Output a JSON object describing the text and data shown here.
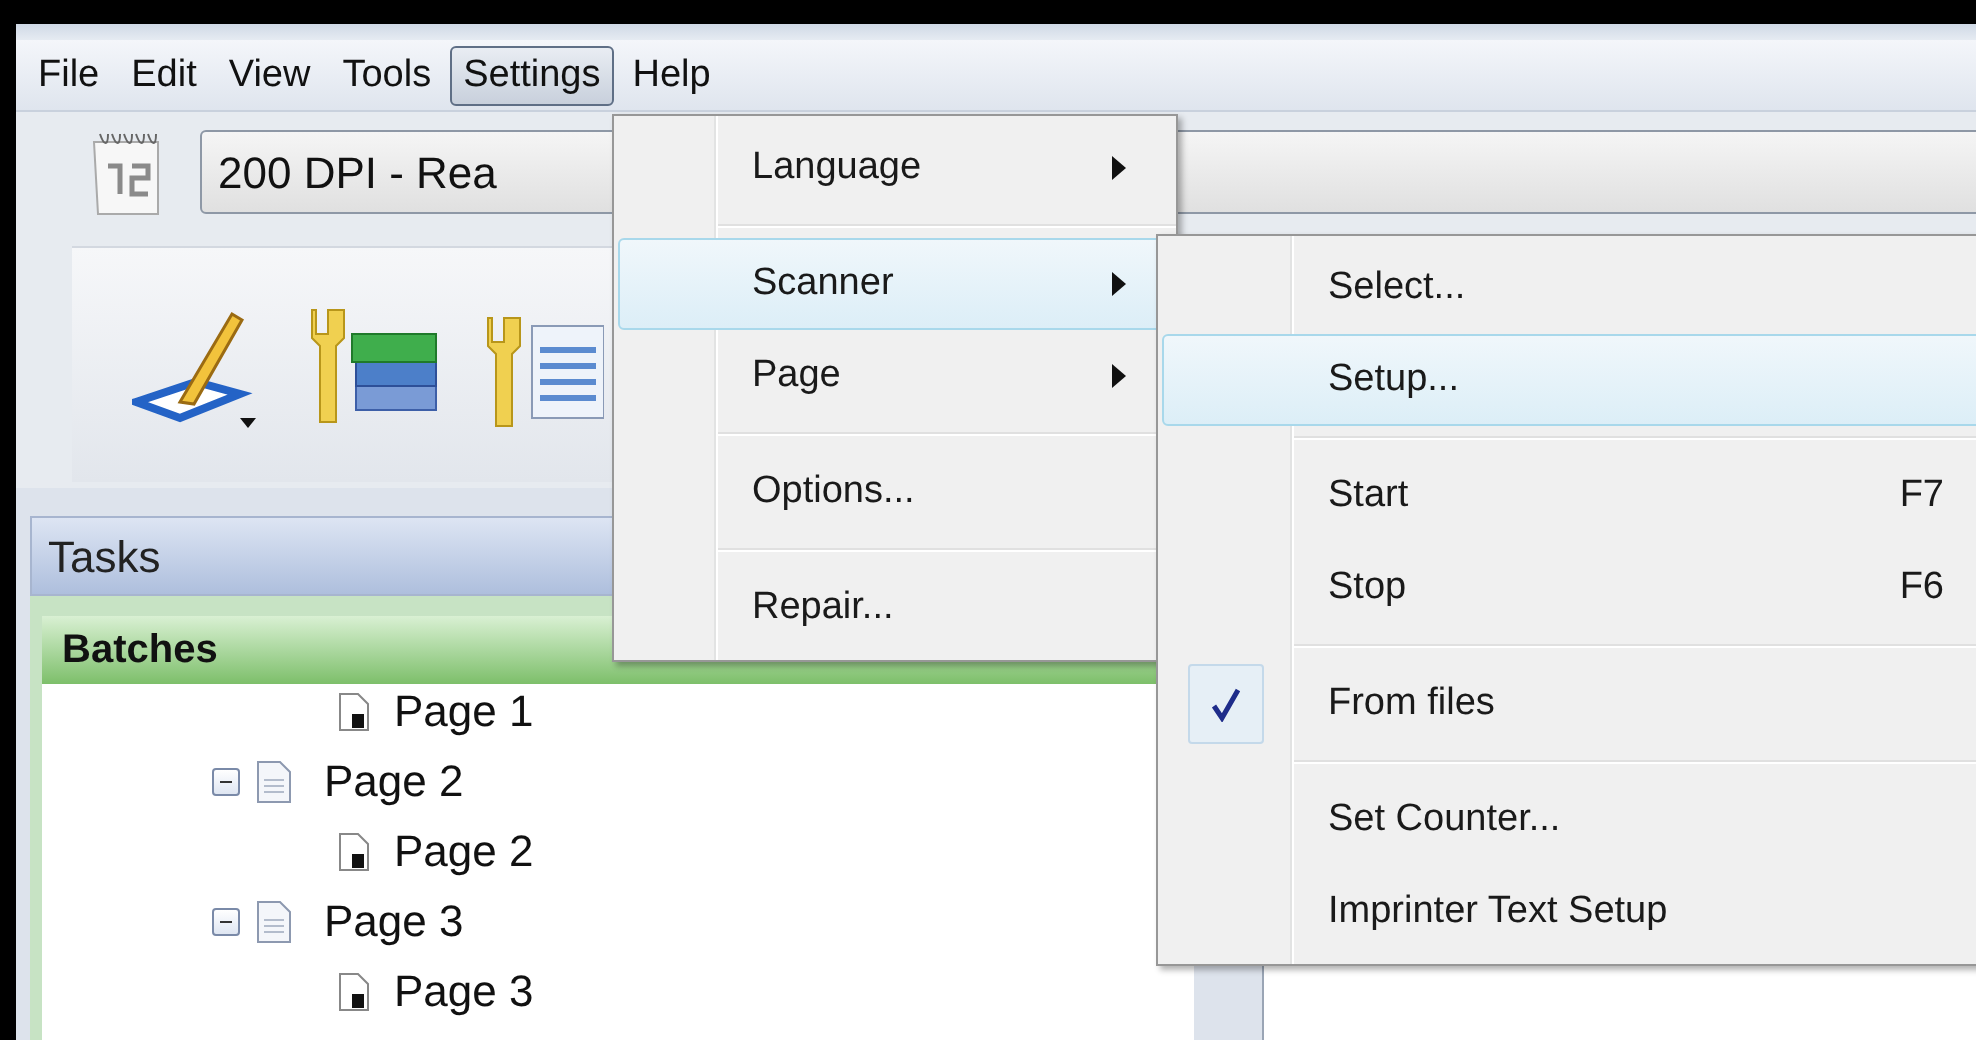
{
  "menubar": [
    {
      "label": "File",
      "selected": false
    },
    {
      "label": "Edit",
      "selected": false
    },
    {
      "label": "View",
      "selected": false
    },
    {
      "label": "Tools",
      "selected": false
    },
    {
      "label": "Settings",
      "selected": true
    },
    {
      "label": "Help",
      "selected": false
    }
  ],
  "toolbar": {
    "profile_combo": {
      "value": "200 DPI - Rea"
    }
  },
  "tasks_panel": {
    "title": "Tasks",
    "section": "Batches",
    "tree": {
      "partial_children": [
        {
          "label": "Page 1"
        }
      ],
      "items": [
        {
          "label": "Page 2",
          "expanded": true,
          "children": [
            {
              "label": "Page 2"
            }
          ]
        },
        {
          "label": "Page 3",
          "expanded": true,
          "children": [
            {
              "label": "Page 3"
            }
          ]
        }
      ]
    }
  },
  "settings_menu": [
    {
      "kind": "item",
      "label": "Language",
      "submenu": true,
      "selected": false
    },
    {
      "kind": "separator"
    },
    {
      "kind": "item",
      "label": "Scanner",
      "submenu": true,
      "selected": true
    },
    {
      "kind": "item",
      "label": "Page",
      "submenu": true,
      "selected": false
    },
    {
      "kind": "separator"
    },
    {
      "kind": "item",
      "label": "Options...",
      "submenu": false,
      "selected": false
    },
    {
      "kind": "separator"
    },
    {
      "kind": "item",
      "label": "Repair...",
      "submenu": false,
      "selected": false
    }
  ],
  "scanner_submenu": [
    {
      "kind": "item",
      "label": "Select...",
      "selected": false,
      "checked": false
    },
    {
      "kind": "item",
      "label": "Setup...",
      "selected": true,
      "checked": false
    },
    {
      "kind": "separator"
    },
    {
      "kind": "item",
      "label": "Start",
      "shortcut": "F7",
      "selected": false,
      "checked": false
    },
    {
      "kind": "item",
      "label": "Stop",
      "shortcut": "F6",
      "selected": false,
      "checked": false
    },
    {
      "kind": "separator"
    },
    {
      "kind": "item",
      "label": "From files",
      "selected": false,
      "checked": true
    },
    {
      "kind": "separator"
    },
    {
      "kind": "item",
      "label": "Set Counter...",
      "selected": false,
      "checked": false
    },
    {
      "kind": "item",
      "label": "Imprinter Text Setup",
      "selected": false,
      "checked": false
    }
  ]
}
